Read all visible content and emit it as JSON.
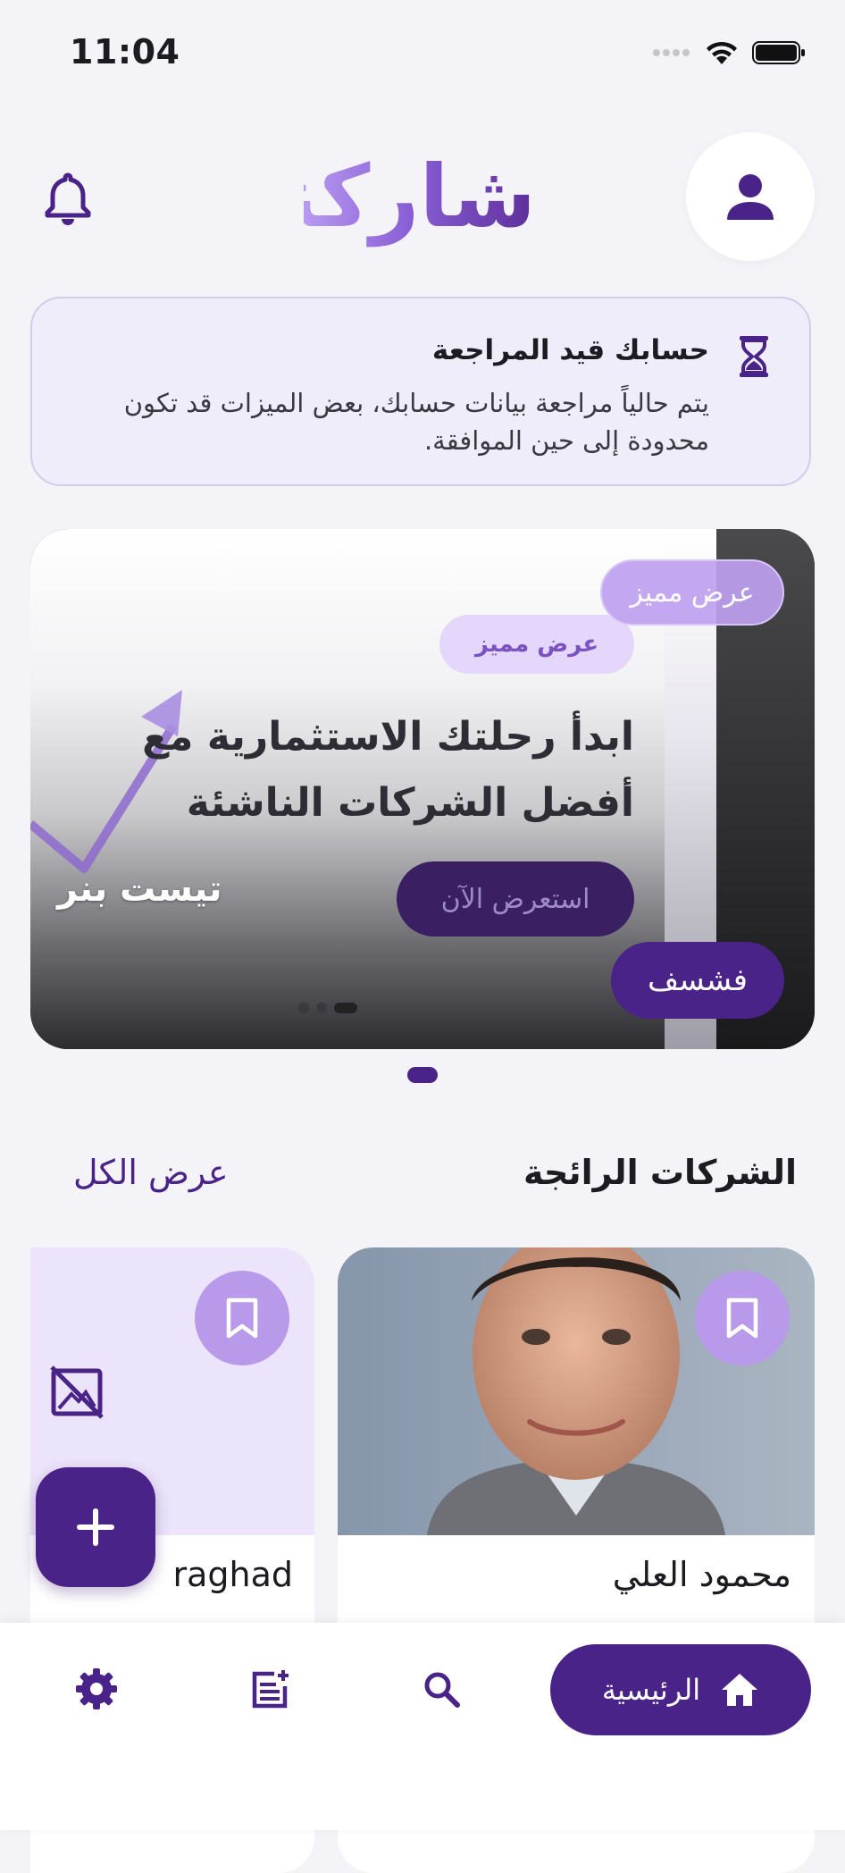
{
  "status_bar": {
    "time": "11:04"
  },
  "header": {
    "logo_text": "شاركني"
  },
  "notice": {
    "title": "حسابك قيد المراجعة",
    "body": "يتم حالياً مراجعة بيانات حسابك، بعض الميزات قد تكون محدودة إلى حين الموافقة."
  },
  "banner": {
    "featured_badge": "عرض مميز",
    "title": "تيست بنر",
    "discover_label": "فشسف",
    "inner_badge": "عرض مميز",
    "inner_headline": "ابدأ رحلتك الاستثمارية مع أفضل الشركات الناشئة",
    "inner_cta": "استعرض الآن"
  },
  "section": {
    "title": "الشركات الرائجة",
    "view_all": "عرض الكل"
  },
  "cards": [
    {
      "name": "محمود العلي"
    },
    {
      "name": "raghad"
    }
  ],
  "bottom_nav": {
    "home_label": "الرئيسية"
  },
  "colors": {
    "primary": "#4a2388",
    "accent_light": "#b899ea",
    "background": "#f4f3f7"
  }
}
